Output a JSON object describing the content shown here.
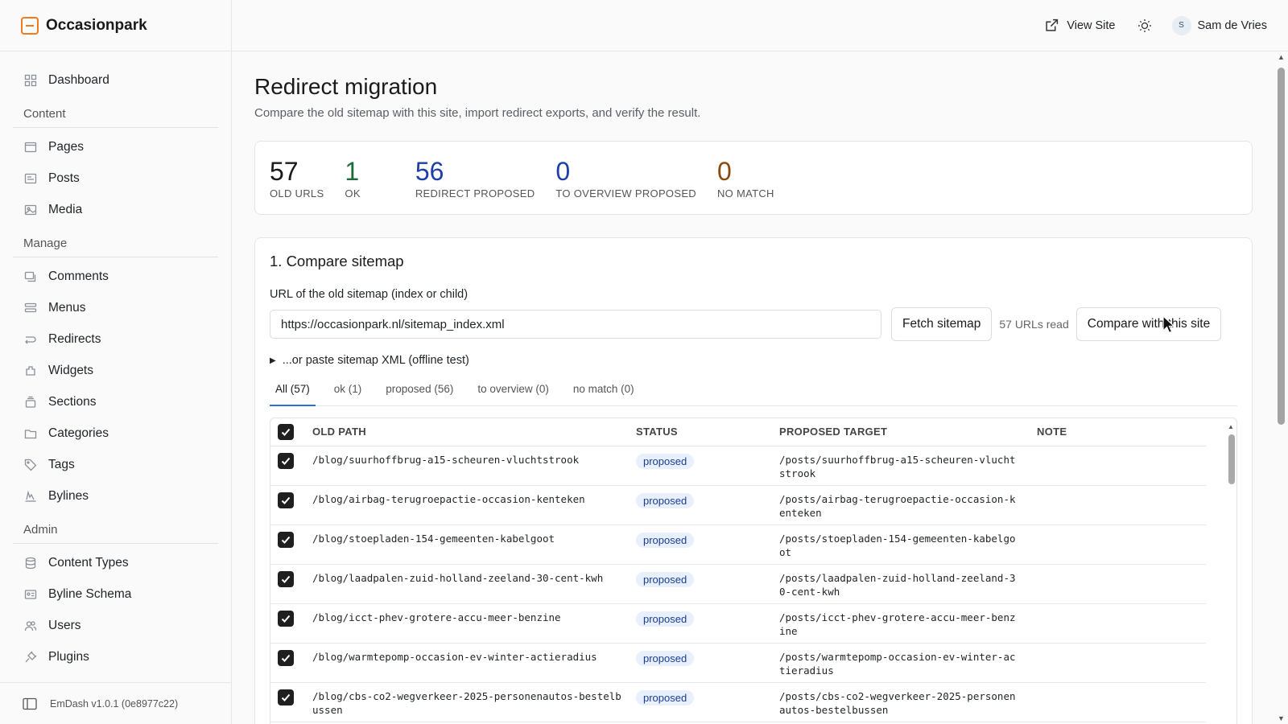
{
  "brand": {
    "name": "Occasionpark",
    "accent": "#f07b1f"
  },
  "sidebar": {
    "dashboard": "Dashboard",
    "sections": [
      {
        "title": "Content",
        "items": [
          {
            "label": "Pages",
            "icon": "pages-icon"
          },
          {
            "label": "Posts",
            "icon": "posts-icon"
          },
          {
            "label": "Media",
            "icon": "media-icon"
          }
        ]
      },
      {
        "title": "Manage",
        "items": [
          {
            "label": "Comments",
            "icon": "comments-icon"
          },
          {
            "label": "Menus",
            "icon": "menus-icon"
          },
          {
            "label": "Redirects",
            "icon": "redirects-icon"
          },
          {
            "label": "Widgets",
            "icon": "widgets-icon"
          },
          {
            "label": "Sections",
            "icon": "sections-icon"
          },
          {
            "label": "Categories",
            "icon": "categories-icon"
          },
          {
            "label": "Tags",
            "icon": "tag-icon"
          },
          {
            "label": "Bylines",
            "icon": "bylines-icon"
          }
        ]
      },
      {
        "title": "Admin",
        "items": [
          {
            "label": "Content Types",
            "icon": "database-icon"
          },
          {
            "label": "Byline Schema",
            "icon": "id-card-icon"
          },
          {
            "label": "Users",
            "icon": "users-icon"
          },
          {
            "label": "Plugins",
            "icon": "plug-icon"
          }
        ]
      }
    ],
    "footer": "EmDash v1.0.1 (0e8977c22)"
  },
  "topbar": {
    "view_site": "View Site",
    "user_initial": "S",
    "user_name": "Sam de Vries"
  },
  "page": {
    "title": "Redirect migration",
    "subtitle": "Compare the old sitemap with this site, import redirect exports, and verify the result."
  },
  "stats": [
    {
      "value": "57",
      "label": "OLD URLS",
      "color": "#1a1a1a"
    },
    {
      "value": "1",
      "label": "OK",
      "color": "#1d6b3a"
    },
    {
      "value": "56",
      "label": "REDIRECT PROPOSED",
      "color": "#1f3fa8"
    },
    {
      "value": "0",
      "label": "TO OVERVIEW PROPOSED",
      "color": "#1f3fa8"
    },
    {
      "value": "0",
      "label": "NO MATCH",
      "color": "#8a4a0b"
    }
  ],
  "compare": {
    "title": "1. Compare sitemap",
    "field_label": "URL of the old sitemap (index or child)",
    "url_value": "https://occasionpark.nl/sitemap_index.xml",
    "fetch_label": "Fetch sitemap",
    "urls_read": "57 URLs read",
    "compare_label": "Compare with this site",
    "paste_toggle": "...or paste sitemap XML (offline test)",
    "tabs": [
      "All (57)",
      "ok (1)",
      "proposed (56)",
      "to overview (0)",
      "no match (0)"
    ],
    "columns": [
      "OLD PATH",
      "STATUS",
      "PROPOSED TARGET",
      "NOTE"
    ],
    "rows": [
      {
        "old": "/blog/suurhoffbrug-a15-scheuren-vluchtstrook",
        "status": "proposed",
        "target": "/posts/suurhoffbrug-a15-scheuren-vluchtstrook",
        "note": ""
      },
      {
        "old": "/blog/airbag-terugroepactie-occasion-kenteken",
        "status": "proposed",
        "target": "/posts/airbag-terugroepactie-occasion-kenteken",
        "note": ""
      },
      {
        "old": "/blog/stoepladen-154-gemeenten-kabelgoot",
        "status": "proposed",
        "target": "/posts/stoepladen-154-gemeenten-kabelgoot",
        "note": ""
      },
      {
        "old": "/blog/laadpalen-zuid-holland-zeeland-30-cent-kwh",
        "status": "proposed",
        "target": "/posts/laadpalen-zuid-holland-zeeland-30-cent-kwh",
        "note": ""
      },
      {
        "old": "/blog/icct-phev-grotere-accu-meer-benzine",
        "status": "proposed",
        "target": "/posts/icct-phev-grotere-accu-meer-benzine",
        "note": ""
      },
      {
        "old": "/blog/warmtepomp-occasion-ev-winter-actieradius",
        "status": "proposed",
        "target": "/posts/warmtepomp-occasion-ev-winter-actieradius",
        "note": ""
      },
      {
        "old": "/blog/cbs-co2-wegverkeer-2025-personenautos-bestelbussen",
        "status": "proposed",
        "target": "/posts/cbs-co2-wegverkeer-2025-personenautos-bestelbussen",
        "note": ""
      }
    ]
  }
}
